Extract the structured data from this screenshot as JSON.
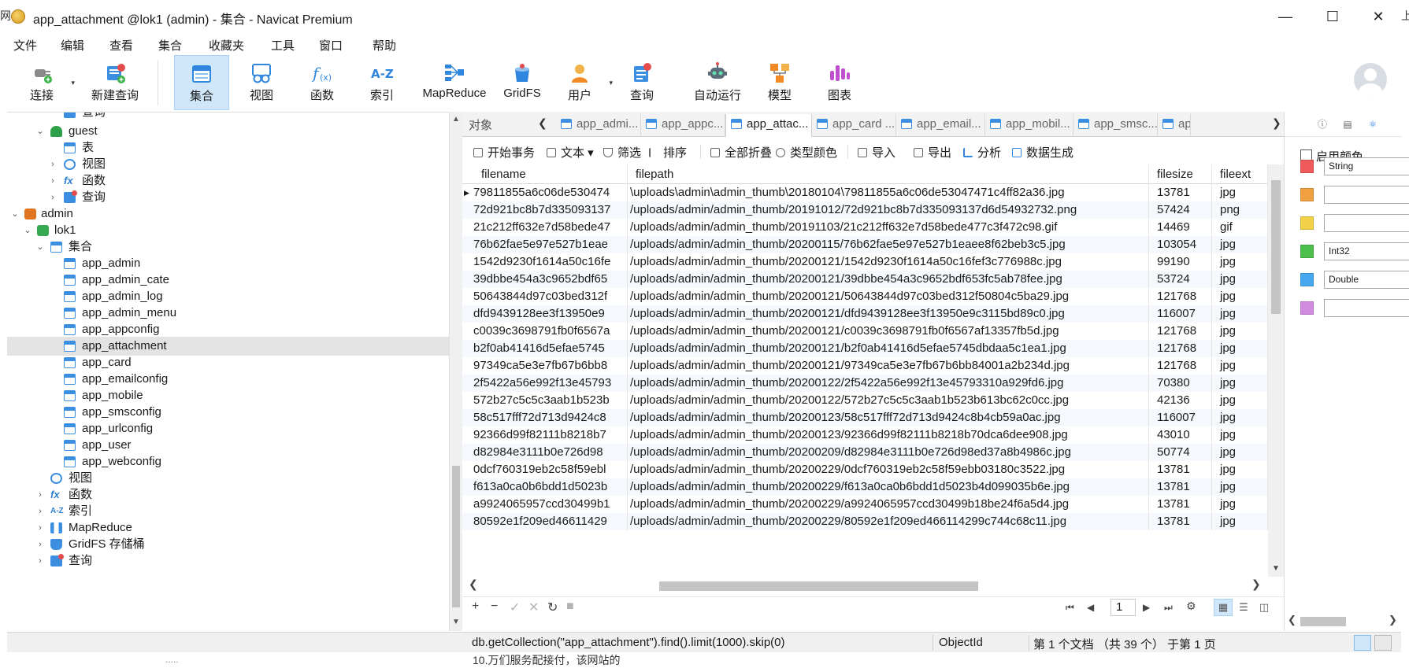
{
  "window": {
    "title": "app_attachment @lok1 (admin) - 集合 - Navicat Premium",
    "controls": [
      "—",
      "☐",
      "✕"
    ],
    "edge_left_char": "网",
    "edge_right_char": "上"
  },
  "menu": [
    "文件",
    "编辑",
    "查看",
    "集合",
    "收藏夹",
    "工具",
    "窗口",
    "帮助"
  ],
  "toolbar": [
    {
      "label": "连接",
      "icon": "plug-icon"
    },
    {
      "label": "新建查询",
      "icon": "new-query-icon"
    },
    {
      "label": "集合",
      "icon": "collection-icon",
      "active": true
    },
    {
      "label": "视图",
      "icon": "view-icon"
    },
    {
      "label": "函数",
      "icon": "function-icon"
    },
    {
      "label": "索引",
      "icon": "index-icon"
    },
    {
      "label": "MapReduce",
      "icon": "mapreduce-icon"
    },
    {
      "label": "GridFS",
      "icon": "gridfs-icon"
    },
    {
      "label": "用户",
      "icon": "user-icon"
    },
    {
      "label": "查询",
      "icon": "query-icon"
    },
    {
      "label": "自动运行",
      "icon": "robot-icon"
    },
    {
      "label": "模型",
      "icon": "model-icon"
    },
    {
      "label": "图表",
      "icon": "chart-icon"
    }
  ],
  "tree": {
    "top_partial": "查询",
    "guest": {
      "label": "guest",
      "children": [
        "表",
        "视图",
        "函数",
        "查询"
      ]
    },
    "admin": "admin",
    "lok1": "lok1",
    "collections_label": "集合",
    "collections": [
      "app_admin",
      "app_admin_cate",
      "app_admin_log",
      "app_admin_menu",
      "app_appconfig",
      "app_attachment",
      "app_card",
      "app_emailconfig",
      "app_mobile",
      "app_smsconfig",
      "app_urlconfig",
      "app_user",
      "app_webconfig"
    ],
    "selected": "app_attachment",
    "lok1_rest": [
      "视图",
      "函数",
      "索引",
      "MapReduce",
      "GridFS 存储桶",
      "查询"
    ]
  },
  "tabs": {
    "object_label": "对象",
    "items": [
      "app_admi...",
      "app_appc...",
      "app_attac...",
      "app_card ...",
      "app_email...",
      "app_mobil...",
      "app_smsc...",
      "ap"
    ],
    "active_index": 2
  },
  "object_toolbar": [
    "开始事务",
    "文本",
    "筛选",
    "排序",
    "全部折叠",
    "类型颜色",
    "导入",
    "导出",
    "分析",
    "数据生成"
  ],
  "grid": {
    "columns": [
      "filename",
      "filepath",
      "filesize",
      "fileext"
    ],
    "rows": [
      [
        "79811855a6c06de530474",
        "\\uploads\\admin\\admin_thumb\\20180104\\79811855a6c06de53047471c4ff82a36.jpg",
        "13781",
        "jpg"
      ],
      [
        "72d921bc8b7d335093137",
        "/uploads/admin/admin_thumb/20191012/72d921bc8b7d335093137d6d54932732.png",
        "57424",
        "png"
      ],
      [
        "21c212ff632e7d58bede47",
        "/uploads/admin/admin_thumb/20191103/21c212ff632e7d58bede477c3f472c98.gif",
        "14469",
        "gif"
      ],
      [
        "76b62fae5e97e527b1eae",
        "/uploads/admin/admin_thumb/20200115/76b62fae5e97e527b1eaee8f62beb3c5.jpg",
        "103054",
        "jpg"
      ],
      [
        "1542d9230f1614a50c16fe",
        "/uploads/admin/admin_thumb/20200121/1542d9230f1614a50c16fef3c776988c.jpg",
        "99190",
        "jpg"
      ],
      [
        "39dbbe454a3c9652bdf65",
        "/uploads/admin/admin_thumb/20200121/39dbbe454a3c9652bdf653fc5ab78fee.jpg",
        "53724",
        "jpg"
      ],
      [
        "50643844d97c03bed312f",
        "/uploads/admin/admin_thumb/20200121/50643844d97c03bed312f50804c5ba29.jpg",
        "121768",
        "jpg"
      ],
      [
        "dfd9439128ee3f13950e9",
        "/uploads/admin/admin_thumb/20200121/dfd9439128ee3f13950e9c3115bd89c0.jpg",
        "116007",
        "jpg"
      ],
      [
        "c0039c3698791fb0f6567a",
        "/uploads/admin/admin_thumb/20200121/c0039c3698791fb0f6567af13357fb5d.jpg",
        "121768",
        "jpg"
      ],
      [
        "b2f0ab41416d5efae5745",
        "/uploads/admin/admin_thumb/20200121/b2f0ab41416d5efae5745dbdaa5c1ea1.jpg",
        "121768",
        "jpg"
      ],
      [
        "97349ca5e3e7fb67b6bb8",
        "/uploads/admin/admin_thumb/20200121/97349ca5e3e7fb67b6bb84001a2b234d.jpg",
        "121768",
        "jpg"
      ],
      [
        "2f5422a56e992f13e45793",
        "/uploads/admin/admin_thumb/20200122/2f5422a56e992f13e45793310a929fd6.jpg",
        "70380",
        "jpg"
      ],
      [
        "572b27c5c5c3aab1b523b",
        "/uploads/admin/admin_thumb/20200122/572b27c5c5c3aab1b523b613bc62c0cc.jpg",
        "42136",
        "jpg"
      ],
      [
        "58c517fff72d713d9424c8",
        "/uploads/admin/admin_thumb/20200123/58c517fff72d713d9424c8b4cb59a0ac.jpg",
        "116007",
        "jpg"
      ],
      [
        "92366d99f82111b8218b7",
        "/uploads/admin/admin_thumb/20200123/92366d99f82111b8218b70dca6dee908.jpg",
        "43010",
        "jpg"
      ],
      [
        "d82984e3111b0e726d98",
        "/uploads/admin/admin_thumb/20200209/d82984e3111b0e726d98ed37a8b4986c.jpg",
        "50774",
        "jpg"
      ],
      [
        "0dcf760319eb2c58f59ebl",
        "/uploads/admin/admin_thumb/20200229/0dcf760319eb2c58f59ebb03180c3522.jpg",
        "13781",
        "jpg"
      ],
      [
        "f613a0ca0b6bdd1d5023b",
        "/uploads/admin/admin_thumb/20200229/f613a0ca0b6bdd1d5023b4d099035b6e.jpg",
        "13781",
        "jpg"
      ],
      [
        "a9924065957ccd30499b1",
        "/uploads/admin/admin_thumb/20200229/a9924065957ccd30499b18be24f6a5d4.jpg",
        "13781",
        "jpg"
      ],
      [
        "80592e1f209ed46611429",
        "/uploads/admin/admin_thumb/20200229/80592e1f209ed466114299c744c68c11.jpg",
        "13781",
        "jpg"
      ]
    ]
  },
  "bottom_bar": {
    "page": "1"
  },
  "status": {
    "query": "db.getCollection(\"app_attachment\").find().limit(1000).skip(0)",
    "type": "ObjectId",
    "docs": "第 1 个文档 （共 39 个） 于第 1 页"
  },
  "right_panel": {
    "checkbox_label": "启用颜色",
    "colors": [
      {
        "color": "#f05a5a",
        "value": "String"
      },
      {
        "color": "#f0a040",
        "value": ""
      },
      {
        "color": "#f2d048",
        "value": ""
      },
      {
        "color": "#4cbf4c",
        "value": "Int32"
      },
      {
        "color": "#46a9f0",
        "value": "Double"
      },
      {
        "color": "#d38be0",
        "value": ""
      }
    ]
  },
  "below_window_text": "10.万们服务配接付，该网站的",
  "below_window_text_2": "....."
}
